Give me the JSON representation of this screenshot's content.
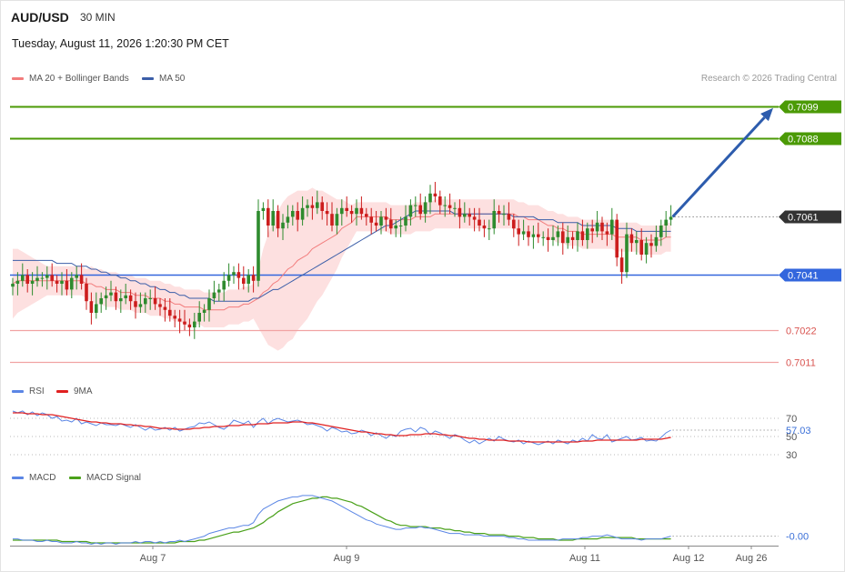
{
  "header": {
    "pair": "AUD/USD",
    "timeframe": "30 MIN",
    "datetime": "Tuesday, August 11, 2026 1:20:30 PM CET",
    "credit": "Research © 2026 Trading Central"
  },
  "legend": {
    "ma20_bb": "MA 20 + Bollinger Bands",
    "ma50": "MA 50",
    "rsi": "RSI",
    "rsi_ma": "9MA",
    "macd": "MACD",
    "macd_signal": "MACD Signal"
  },
  "colors": {
    "up": "#2e8b2e",
    "down": "#cc1d1d",
    "resistance": "#4b9a06",
    "support": "#3366dd",
    "bb_fill": "#fde0e0",
    "ma20": "#f27c7c",
    "ma50": "#3b5ea8",
    "target_arrow": "#2d5cad",
    "current_price_bg": "#333333",
    "rsi": "#5b86e5",
    "rsi_ma": "#e02020",
    "macd": "#5b86e5",
    "macd_signal": "#4aa11a"
  },
  "chart_data": [
    {
      "type": "candlestick",
      "title": "AUD/USD 30 MIN",
      "x_tick_labels": [
        "Aug 7",
        "Aug 9",
        "Aug 11",
        "Aug 12",
        "Aug 26"
      ],
      "ylim": [
        0.7008,
        0.7103
      ],
      "current_price": {
        "value": 0.7061,
        "label": "0.7061"
      },
      "levels": [
        {
          "value": 0.7099,
          "label": "0.7099",
          "kind": "resistance"
        },
        {
          "value": 0.7088,
          "label": "0.7088",
          "kind": "resistance"
        },
        {
          "value": 0.7041,
          "label": "0.7041",
          "kind": "support"
        },
        {
          "value": 0.7022,
          "label": "0.7022",
          "kind": "support"
        },
        {
          "value": 0.7011,
          "label": "0.7011",
          "kind": "support"
        }
      ],
      "target_arrow": {
        "from": 0.7061,
        "to": 0.7099
      },
      "closes": [
        0.7038,
        0.7039,
        0.7041,
        0.7038,
        0.7039,
        0.704,
        0.704,
        0.7041,
        0.7039,
        0.7038,
        0.7039,
        0.7036,
        0.704,
        0.7041,
        0.7038,
        0.7032,
        0.7028,
        0.7031,
        0.7033,
        0.7034,
        0.7035,
        0.7032,
        0.7033,
        0.7034,
        0.7032,
        0.703,
        0.7031,
        0.7033,
        0.7033,
        0.7031,
        0.703,
        0.7029,
        0.7027,
        0.7026,
        0.7025,
        0.7024,
        0.7023,
        0.7025,
        0.7028,
        0.7029,
        0.7033,
        0.7035,
        0.7036,
        0.7039,
        0.7041,
        0.7042,
        0.704,
        0.7038,
        0.7041,
        0.7039,
        0.7063,
        0.7064,
        0.7058,
        0.7063,
        0.7057,
        0.7059,
        0.7061,
        0.7063,
        0.706,
        0.7064,
        0.7065,
        0.7064,
        0.7066,
        0.7063,
        0.7062,
        0.7058,
        0.7062,
        0.7064,
        0.7063,
        0.7062,
        0.7064,
        0.7062,
        0.7061,
        0.7059,
        0.7058,
        0.7061,
        0.706,
        0.7057,
        0.7058,
        0.7058,
        0.7061,
        0.7065,
        0.7065,
        0.7062,
        0.7066,
        0.7069,
        0.7068,
        0.7065,
        0.7065,
        0.7064,
        0.7064,
        0.7061,
        0.7062,
        0.7061,
        0.706,
        0.7058,
        0.7057,
        0.7057,
        0.7063,
        0.7062,
        0.7062,
        0.706,
        0.7057,
        0.7055,
        0.7056,
        0.7054,
        0.7055,
        0.7054,
        0.7054,
        0.7053,
        0.7054,
        0.7056,
        0.7052,
        0.7054,
        0.7053,
        0.7056,
        0.7053,
        0.7057,
        0.7056,
        0.7059,
        0.7056,
        0.7055,
        0.706,
        0.7047,
        0.7042,
        0.7055,
        0.7052,
        0.7053,
        0.7048,
        0.7052,
        0.7051,
        0.7054,
        0.7058,
        0.706,
        0.7061
      ],
      "ma20": [
        0.7038,
        0.7039,
        0.7039,
        0.7039,
        0.7039,
        0.7039,
        0.7039,
        0.7039,
        0.7039,
        0.7039,
        0.7039,
        0.7039,
        0.7039,
        0.7039,
        0.7039,
        0.7038,
        0.7038,
        0.7037,
        0.7037,
        0.7036,
        0.7036,
        0.7036,
        0.7035,
        0.7035,
        0.7035,
        0.7034,
        0.7034,
        0.7034,
        0.7033,
        0.7033,
        0.7033,
        0.7032,
        0.7032,
        0.7031,
        0.7031,
        0.703,
        0.703,
        0.703,
        0.703,
        0.7029,
        0.7029,
        0.7029,
        0.7029,
        0.7029,
        0.703,
        0.703,
        0.703,
        0.7031,
        0.7031,
        0.7032,
        0.7033,
        0.7035,
        0.7036,
        0.7038,
        0.7039,
        0.7041,
        0.7043,
        0.7044,
        0.7046,
        0.7047,
        0.7048,
        0.705,
        0.7051,
        0.7052,
        0.7053,
        0.7054,
        0.7055,
        0.7057,
        0.7058,
        0.7059,
        0.7061,
        0.7061,
        0.7061,
        0.7061,
        0.7061,
        0.7061,
        0.7061,
        0.706,
        0.706,
        0.706,
        0.706,
        0.706,
        0.7061,
        0.7061,
        0.7061,
        0.7061,
        0.7062,
        0.7062,
        0.7062,
        0.7062,
        0.7062,
        0.7062,
        0.7062,
        0.7062,
        0.7062,
        0.7062,
        0.7062,
        0.7062,
        0.7062,
        0.7062,
        0.7062,
        0.7062,
        0.7062,
        0.7061,
        0.7061,
        0.706,
        0.706,
        0.706,
        0.7059,
        0.7058,
        0.7058,
        0.7057,
        0.7057,
        0.7056,
        0.7056,
        0.7056,
        0.7055,
        0.7055,
        0.7055,
        0.7055,
        0.7055,
        0.7055,
        0.7055,
        0.7054,
        0.7054,
        0.7054,
        0.7054,
        0.7054,
        0.7053,
        0.7053,
        0.7053,
        0.7053,
        0.7053,
        0.7054,
        0.7054
      ],
      "bb_width": [
        0.0012,
        0.0011,
        0.001,
        0.0009,
        0.0008,
        0.0007,
        0.0006,
        0.0005,
        0.0005,
        0.0005,
        0.0005,
        0.0005,
        0.0005,
        0.0005,
        0.0005,
        0.0005,
        0.0006,
        0.0006,
        0.0006,
        0.0006,
        0.0006,
        0.0006,
        0.0006,
        0.0006,
        0.0006,
        0.0006,
        0.0006,
        0.0006,
        0.0006,
        0.0006,
        0.0006,
        0.0006,
        0.0006,
        0.0006,
        0.0006,
        0.0006,
        0.0006,
        0.0006,
        0.0006,
        0.0006,
        0.0006,
        0.0006,
        0.0006,
        0.0006,
        0.0006,
        0.0006,
        0.0006,
        0.0006,
        0.0006,
        0.0006,
        0.001,
        0.0015,
        0.0019,
        0.0022,
        0.0024,
        0.0025,
        0.0025,
        0.0025,
        0.0024,
        0.0023,
        0.0022,
        0.0021,
        0.0019,
        0.0018,
        0.0016,
        0.0014,
        0.0012,
        0.001,
        0.0008,
        0.0006,
        0.0005,
        0.0005,
        0.0005,
        0.0005,
        0.0005,
        0.0005,
        0.0005,
        0.0005,
        0.0005,
        0.0005,
        0.0005,
        0.0005,
        0.0005,
        0.0005,
        0.0005,
        0.0005,
        0.0005,
        0.0005,
        0.0005,
        0.0005,
        0.0005,
        0.0005,
        0.0005,
        0.0005,
        0.0005,
        0.0005,
        0.0005,
        0.0005,
        0.0005,
        0.0005,
        0.0005,
        0.0005,
        0.0005,
        0.0005,
        0.0005,
        0.0005,
        0.0005,
        0.0005,
        0.0005,
        0.0005,
        0.0005,
        0.0005,
        0.0005,
        0.0005,
        0.0005,
        0.0005,
        0.0005,
        0.0005,
        0.0005,
        0.0005,
        0.0005,
        0.0005,
        0.0005,
        0.0005,
        0.0005,
        0.0005,
        0.0005,
        0.0005,
        0.0005,
        0.0005,
        0.0005,
        0.0005,
        0.0005,
        0.0005,
        0.0005
      ],
      "ma50": [
        0.7046,
        0.7046,
        0.7046,
        0.7046,
        0.7046,
        0.7046,
        0.7046,
        0.7046,
        0.7046,
        0.7045,
        0.7045,
        0.7045,
        0.7045,
        0.7044,
        0.7044,
        0.7044,
        0.7043,
        0.7043,
        0.7042,
        0.7042,
        0.7041,
        0.7041,
        0.704,
        0.704,
        0.7039,
        0.7039,
        0.7038,
        0.7038,
        0.7037,
        0.7037,
        0.7036,
        0.7036,
        0.7035,
        0.7035,
        0.7034,
        0.7034,
        0.7033,
        0.7033,
        0.7033,
        0.7033,
        0.7033,
        0.7032,
        0.7032,
        0.7032,
        0.7032,
        0.7032,
        0.7032,
        0.7032,
        0.7032,
        0.7033,
        0.7033,
        0.7034,
        0.7035,
        0.7036,
        0.7036,
        0.7037,
        0.7038,
        0.7039,
        0.704,
        0.7041,
        0.7042,
        0.7043,
        0.7044,
        0.7045,
        0.7046,
        0.7047,
        0.7048,
        0.7049,
        0.705,
        0.7051,
        0.7052,
        0.7053,
        0.7054,
        0.7055,
        0.7056,
        0.7057,
        0.7058,
        0.7058,
        0.7059,
        0.706,
        0.7061,
        0.7062,
        0.7063,
        0.7063,
        0.7063,
        0.7063,
        0.7063,
        0.7063,
        0.7063,
        0.7063,
        0.7062,
        0.7062,
        0.7062,
        0.7062,
        0.7062,
        0.7062,
        0.7062,
        0.7062,
        0.7062,
        0.7062,
        0.7062,
        0.7062,
        0.7061,
        0.7061,
        0.7061,
        0.7061,
        0.7061,
        0.706,
        0.706,
        0.706,
        0.706,
        0.7059,
        0.7059,
        0.7059,
        0.7059,
        0.7059,
        0.7058,
        0.7058,
        0.7058,
        0.7058,
        0.7058,
        0.7058,
        0.7058,
        0.7057,
        0.7057,
        0.7057,
        0.7057,
        0.7056,
        0.7056,
        0.7056,
        0.7056,
        0.7056,
        0.7056,
        0.7056,
        0.7056
      ]
    },
    {
      "type": "line",
      "title": "RSI",
      "y_tick_labels": [
        "70",
        "50",
        "30"
      ],
      "ylim": [
        22,
        82
      ],
      "current_value": {
        "value": 57.03,
        "label": "57.03"
      },
      "series": [
        {
          "name": "RSI",
          "values": [
            78,
            76,
            78,
            74,
            77,
            73,
            76,
            74,
            70,
            72,
            67,
            68,
            66,
            70,
            64,
            66,
            64,
            62,
            65,
            63,
            63,
            62,
            64,
            62,
            60,
            63,
            60,
            57,
            60,
            57,
            58,
            60,
            57,
            60,
            56,
            58,
            60,
            61,
            65,
            64,
            66,
            63,
            60,
            58,
            62,
            68,
            66,
            64,
            67,
            60,
            66,
            70,
            64,
            68,
            70,
            68,
            66,
            67,
            68,
            66,
            63,
            64,
            62,
            60,
            56,
            60,
            58,
            55,
            56,
            53,
            54,
            57,
            55,
            51,
            54,
            51,
            48,
            52,
            50,
            56,
            58,
            59,
            55,
            60,
            58,
            52,
            56,
            54,
            51,
            48,
            52,
            50,
            46,
            43,
            46,
            42,
            45,
            48,
            45,
            50,
            47,
            45,
            44,
            46,
            42,
            45,
            43,
            41,
            43,
            45,
            42,
            46,
            44,
            42,
            46,
            44,
            48,
            45,
            52,
            48,
            47,
            52,
            44,
            46,
            48,
            50,
            46,
            47,
            49,
            45,
            46,
            45,
            49,
            54,
            57
          ]
        },
        {
          "name": "9MA",
          "values": [
            76,
            76,
            76,
            75,
            75,
            75,
            74,
            74,
            74,
            73,
            72,
            71,
            70,
            69,
            68,
            67,
            66,
            66,
            65,
            65,
            64,
            64,
            64,
            63,
            63,
            62,
            62,
            61,
            61,
            60,
            59,
            59,
            59,
            58,
            58,
            58,
            58,
            59,
            59,
            60,
            60,
            61,
            61,
            61,
            62,
            62,
            62,
            63,
            63,
            63,
            64,
            64,
            64,
            65,
            65,
            65,
            65,
            66,
            66,
            66,
            65,
            65,
            64,
            63,
            62,
            61,
            60,
            59,
            58,
            57,
            56,
            55,
            55,
            54,
            53,
            53,
            52,
            52,
            51,
            51,
            51,
            52,
            52,
            52,
            53,
            53,
            53,
            52,
            52,
            51,
            51,
            50,
            49,
            48,
            48,
            47,
            47,
            46,
            46,
            46,
            46,
            45,
            45,
            45,
            45,
            44,
            44,
            44,
            44,
            44,
            44,
            44,
            44,
            44,
            44,
            44,
            45,
            45,
            45,
            46,
            46,
            46,
            46,
            46,
            46,
            46,
            46,
            46,
            47,
            47,
            47,
            47,
            47,
            48,
            49
          ]
        }
      ]
    },
    {
      "type": "line",
      "title": "MACD",
      "current_value": {
        "value": -0.0,
        "label": "-0.00"
      },
      "ylim": [
        -5,
        42
      ],
      "series": [
        {
          "name": "MACD",
          "values": [
            0,
            0,
            -1,
            -1,
            -1,
            -2,
            -2,
            -1,
            -2,
            -2,
            -3,
            -3,
            -3,
            -2,
            -3,
            -3,
            -4,
            -3,
            -4,
            -3,
            -3,
            -4,
            -3,
            -3,
            -3,
            -2,
            -3,
            -2,
            -2,
            -3,
            -2,
            -3,
            -2,
            -2,
            -1,
            -2,
            -1,
            0,
            1,
            2,
            4,
            5,
            6,
            7,
            8,
            8,
            9,
            10,
            10,
            12,
            18,
            22,
            24,
            26,
            28,
            29,
            30,
            31,
            31,
            32,
            32,
            32,
            31,
            30,
            29,
            28,
            26,
            24,
            22,
            20,
            18,
            16,
            14,
            13,
            11,
            10,
            9,
            8,
            7,
            7,
            8,
            8,
            8,
            9,
            8,
            8,
            7,
            6,
            5,
            4,
            4,
            4,
            3,
            3,
            3,
            3,
            2,
            2,
            2,
            2,
            2,
            1,
            1,
            0,
            0,
            -1,
            -1,
            -1,
            -1,
            -1,
            -1,
            -1,
            0,
            0,
            0,
            0,
            1,
            1,
            2,
            2,
            2,
            3,
            2,
            1,
            0,
            0,
            0,
            0,
            -1,
            0,
            0,
            0,
            0,
            1,
            2
          ]
        },
        {
          "name": "MACD Signal",
          "values": [
            -1,
            -1,
            -1,
            -1,
            -1,
            -1,
            -1,
            -1,
            -1,
            -1,
            -2,
            -2,
            -2,
            -2,
            -2,
            -2,
            -3,
            -3,
            -3,
            -3,
            -3,
            -3,
            -3,
            -3,
            -3,
            -3,
            -3,
            -3,
            -3,
            -3,
            -3,
            -3,
            -3,
            -3,
            -2,
            -2,
            -2,
            -2,
            -1,
            -1,
            0,
            1,
            2,
            3,
            4,
            5,
            5,
            6,
            7,
            8,
            10,
            12,
            15,
            17,
            20,
            22,
            24,
            26,
            27,
            28,
            29,
            30,
            30,
            31,
            31,
            30,
            30,
            29,
            28,
            27,
            25,
            24,
            22,
            20,
            18,
            16,
            14,
            13,
            11,
            10,
            10,
            9,
            9,
            9,
            9,
            8,
            8,
            8,
            7,
            7,
            6,
            6,
            5,
            5,
            4,
            4,
            4,
            3,
            3,
            3,
            3,
            2,
            2,
            2,
            1,
            1,
            1,
            0,
            0,
            0,
            0,
            -1,
            -1,
            -1,
            -1,
            0,
            0,
            0,
            0,
            0,
            1,
            1,
            1,
            1,
            1,
            1,
            1,
            0,
            0,
            0,
            0,
            0,
            0,
            0,
            0
          ]
        }
      ]
    }
  ]
}
